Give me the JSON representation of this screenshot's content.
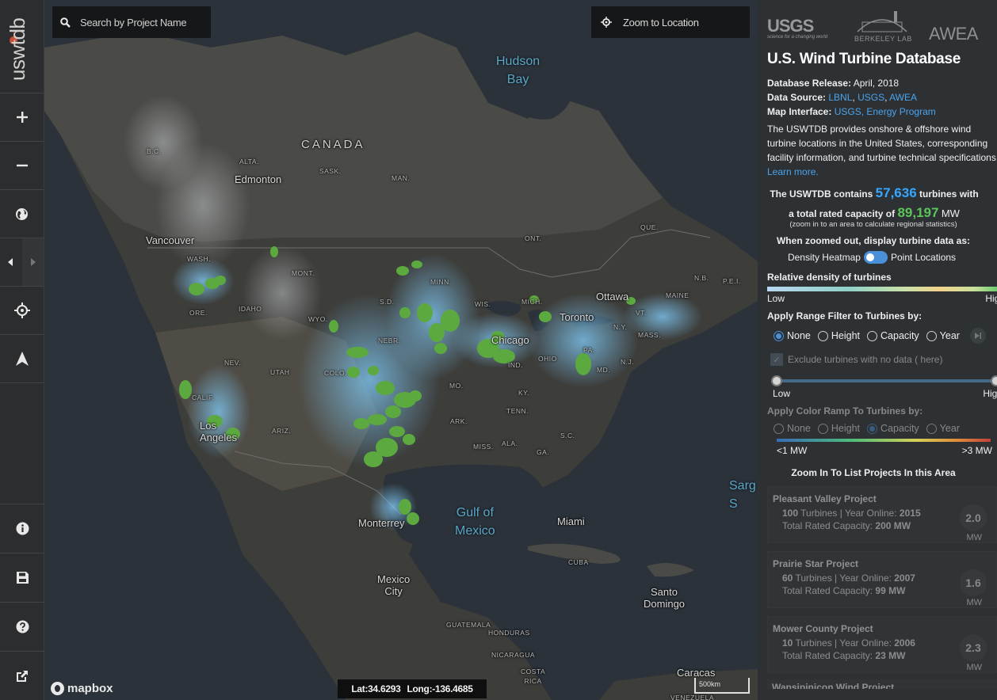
{
  "app": {
    "logo_text": "uswtdb"
  },
  "toolbar": {
    "buttons": [
      {
        "name": "zoom-in",
        "icon": "plus-icon"
      },
      {
        "name": "zoom-out",
        "icon": "minus-icon"
      },
      {
        "name": "basemap",
        "icon": "globe-icon"
      },
      {
        "name": "collapse",
        "icon": "chevron-left-icon"
      },
      {
        "name": "locate",
        "icon": "crosshair-icon"
      },
      {
        "name": "north",
        "icon": "navigation-arrow-icon"
      },
      {
        "name": "info",
        "icon": "info-icon"
      },
      {
        "name": "save",
        "icon": "save-icon"
      },
      {
        "name": "help",
        "icon": "help-icon"
      },
      {
        "name": "external",
        "icon": "external-link-icon"
      }
    ]
  },
  "map": {
    "search_placeholder": "Search by Project Name",
    "zoom_to_location": "Zoom to Location",
    "attribution": "mapbox",
    "lat": "Lat:34.6293",
    "long": "Long:-136.4685",
    "scale": "500km",
    "labels": {
      "canada": "CANADA",
      "hudson_bay_1": "Hudson",
      "hudson_bay_2": "Bay",
      "gulf_1": "Gulf of",
      "gulf_2": "Mexico",
      "edmonton": "Edmonton",
      "vancouver": "Vancouver",
      "los_angeles_1": "Los",
      "los_angeles_2": "Angeles",
      "ottawa": "Ottawa",
      "toronto": "Toronto",
      "chicago": "Chicago",
      "miami": "Miami",
      "monterrey": "Monterrey",
      "mexico_city_1": "Mexico",
      "mexico_city_2": "City",
      "santo_domingo_1": "Santo",
      "santo_domingo_2": "Domingo",
      "caracas": "Caracas",
      "sargasso_1": "Sarg",
      "sargasso_2": "S",
      "bc": "B.C.",
      "alta": "ALTA.",
      "sask": "SASK.",
      "man": "MAN.",
      "ont": "ONT.",
      "que": "QUE.",
      "nb": "N.B.",
      "pei": "P.E.I.",
      "maine": "MAINE",
      "wash": "WASH.",
      "ore": "ORE.",
      "idaho": "IDAHO",
      "mont": "MONT.",
      "wyo": "WYO.",
      "nev": "NEV.",
      "utah": "UTAH",
      "calif": "CALIF.",
      "ariz": "ARIZ.",
      "colo": "COLO.",
      "nebr": "NEBR.",
      "sd": "S.D.",
      "minn": "MINN.",
      "wis": "WIS.",
      "mich": "MICH.",
      "ohio": "OHIO",
      "ind": "IND.",
      "pa": "PA.",
      "ny": "N.Y.",
      "vt": "VT.",
      "mass": "MASS.",
      "nj": "N.J.",
      "md": "MD.",
      "mo": "MO.",
      "ky": "KY.",
      "tenn": "TENN.",
      "ark": "ARK.",
      "miss": "MISS.",
      "ala": "ALA.",
      "ga": "GA.",
      "sc": "S.C.",
      "cuba": "CUBA",
      "guatemala": "GUATEMALA",
      "honduras": "HONDURAS",
      "nicaragua": "NICARAGUA",
      "costa_rica_1": "COSTA",
      "costa_rica_2": "RICA",
      "venezuela": "VENEZUELA"
    }
  },
  "panel": {
    "logos": {
      "usgs": "USGS",
      "usgs_tag": "science for a changing world",
      "lbl": "BERKELEY LAB",
      "awea": "AWEA"
    },
    "title": "U.S. Wind Turbine Database",
    "release_label": "Database Release:",
    "release_value": "April, 2018",
    "source_label": "Data Source:",
    "source_links": [
      "LBNL",
      "USGS",
      "AWEA"
    ],
    "interface_label": "Map Interface:",
    "interface_link": "USGS, Energy Program",
    "description": "The USWTDB provides onshore & offshore wind turbine locations in the United States, corresponding facility information, and turbine technical specifications.",
    "learn_more": "Learn more.",
    "stats_pre": "The USWTDB contains",
    "turbine_count": "57,636",
    "stats_mid": "turbines with",
    "stats_line2_pre": "a total rated capacity of",
    "capacity_total": "89,197",
    "capacity_unit": "MW",
    "stats_note": "(zoom in to an area to calculate regional statistics)",
    "display_header": "When zoomed out, display turbine data as:",
    "display_left": "Density Heatmap",
    "display_right": "Point Locations",
    "density_header": "Relative density of turbines",
    "density_low": "Low",
    "density_high": "High",
    "range_header": "Apply Range Filter to Turbines by:",
    "range_options": [
      "None",
      "Height",
      "Capacity",
      "Year"
    ],
    "range_selected": "None",
    "exclude_label": "Exclude turbines with no data ( here)",
    "slider_low": "Low",
    "slider_high": "High",
    "ramp_header": "Apply Color Ramp To Turbines by:",
    "ramp_options": [
      "None",
      "Height",
      "Capacity",
      "Year"
    ],
    "ramp_selected": "Capacity",
    "ramp_low": "<1 MW",
    "ramp_high": ">3 MW",
    "list_header": "Zoom In To List Projects In this Area",
    "projects": [
      {
        "name": "Pleasant Valley Project",
        "turbines": "100",
        "turbines_label": "Turbines | Year Online:",
        "year": "2015",
        "cap_label": "Total Rated Capacity:",
        "capacity": "200 MW",
        "unit_cap": "2.0",
        "unit": "MW"
      },
      {
        "name": "Prairie Star Project",
        "turbines": "60",
        "turbines_label": "Turbines | Year Online:",
        "year": "2007",
        "cap_label": "Total Rated Capacity:",
        "capacity": "99 MW",
        "unit_cap": "1.6",
        "unit": "MW"
      },
      {
        "name": "Mower County Project",
        "turbines": "10",
        "turbines_label": "Turbines | Year Online:",
        "year": "2006",
        "cap_label": "Total Rated Capacity:",
        "capacity": "23 MW",
        "unit_cap": "2.3",
        "unit": "MW"
      }
    ],
    "next_project_peek": "Wapsipinicon Wind Project"
  }
}
